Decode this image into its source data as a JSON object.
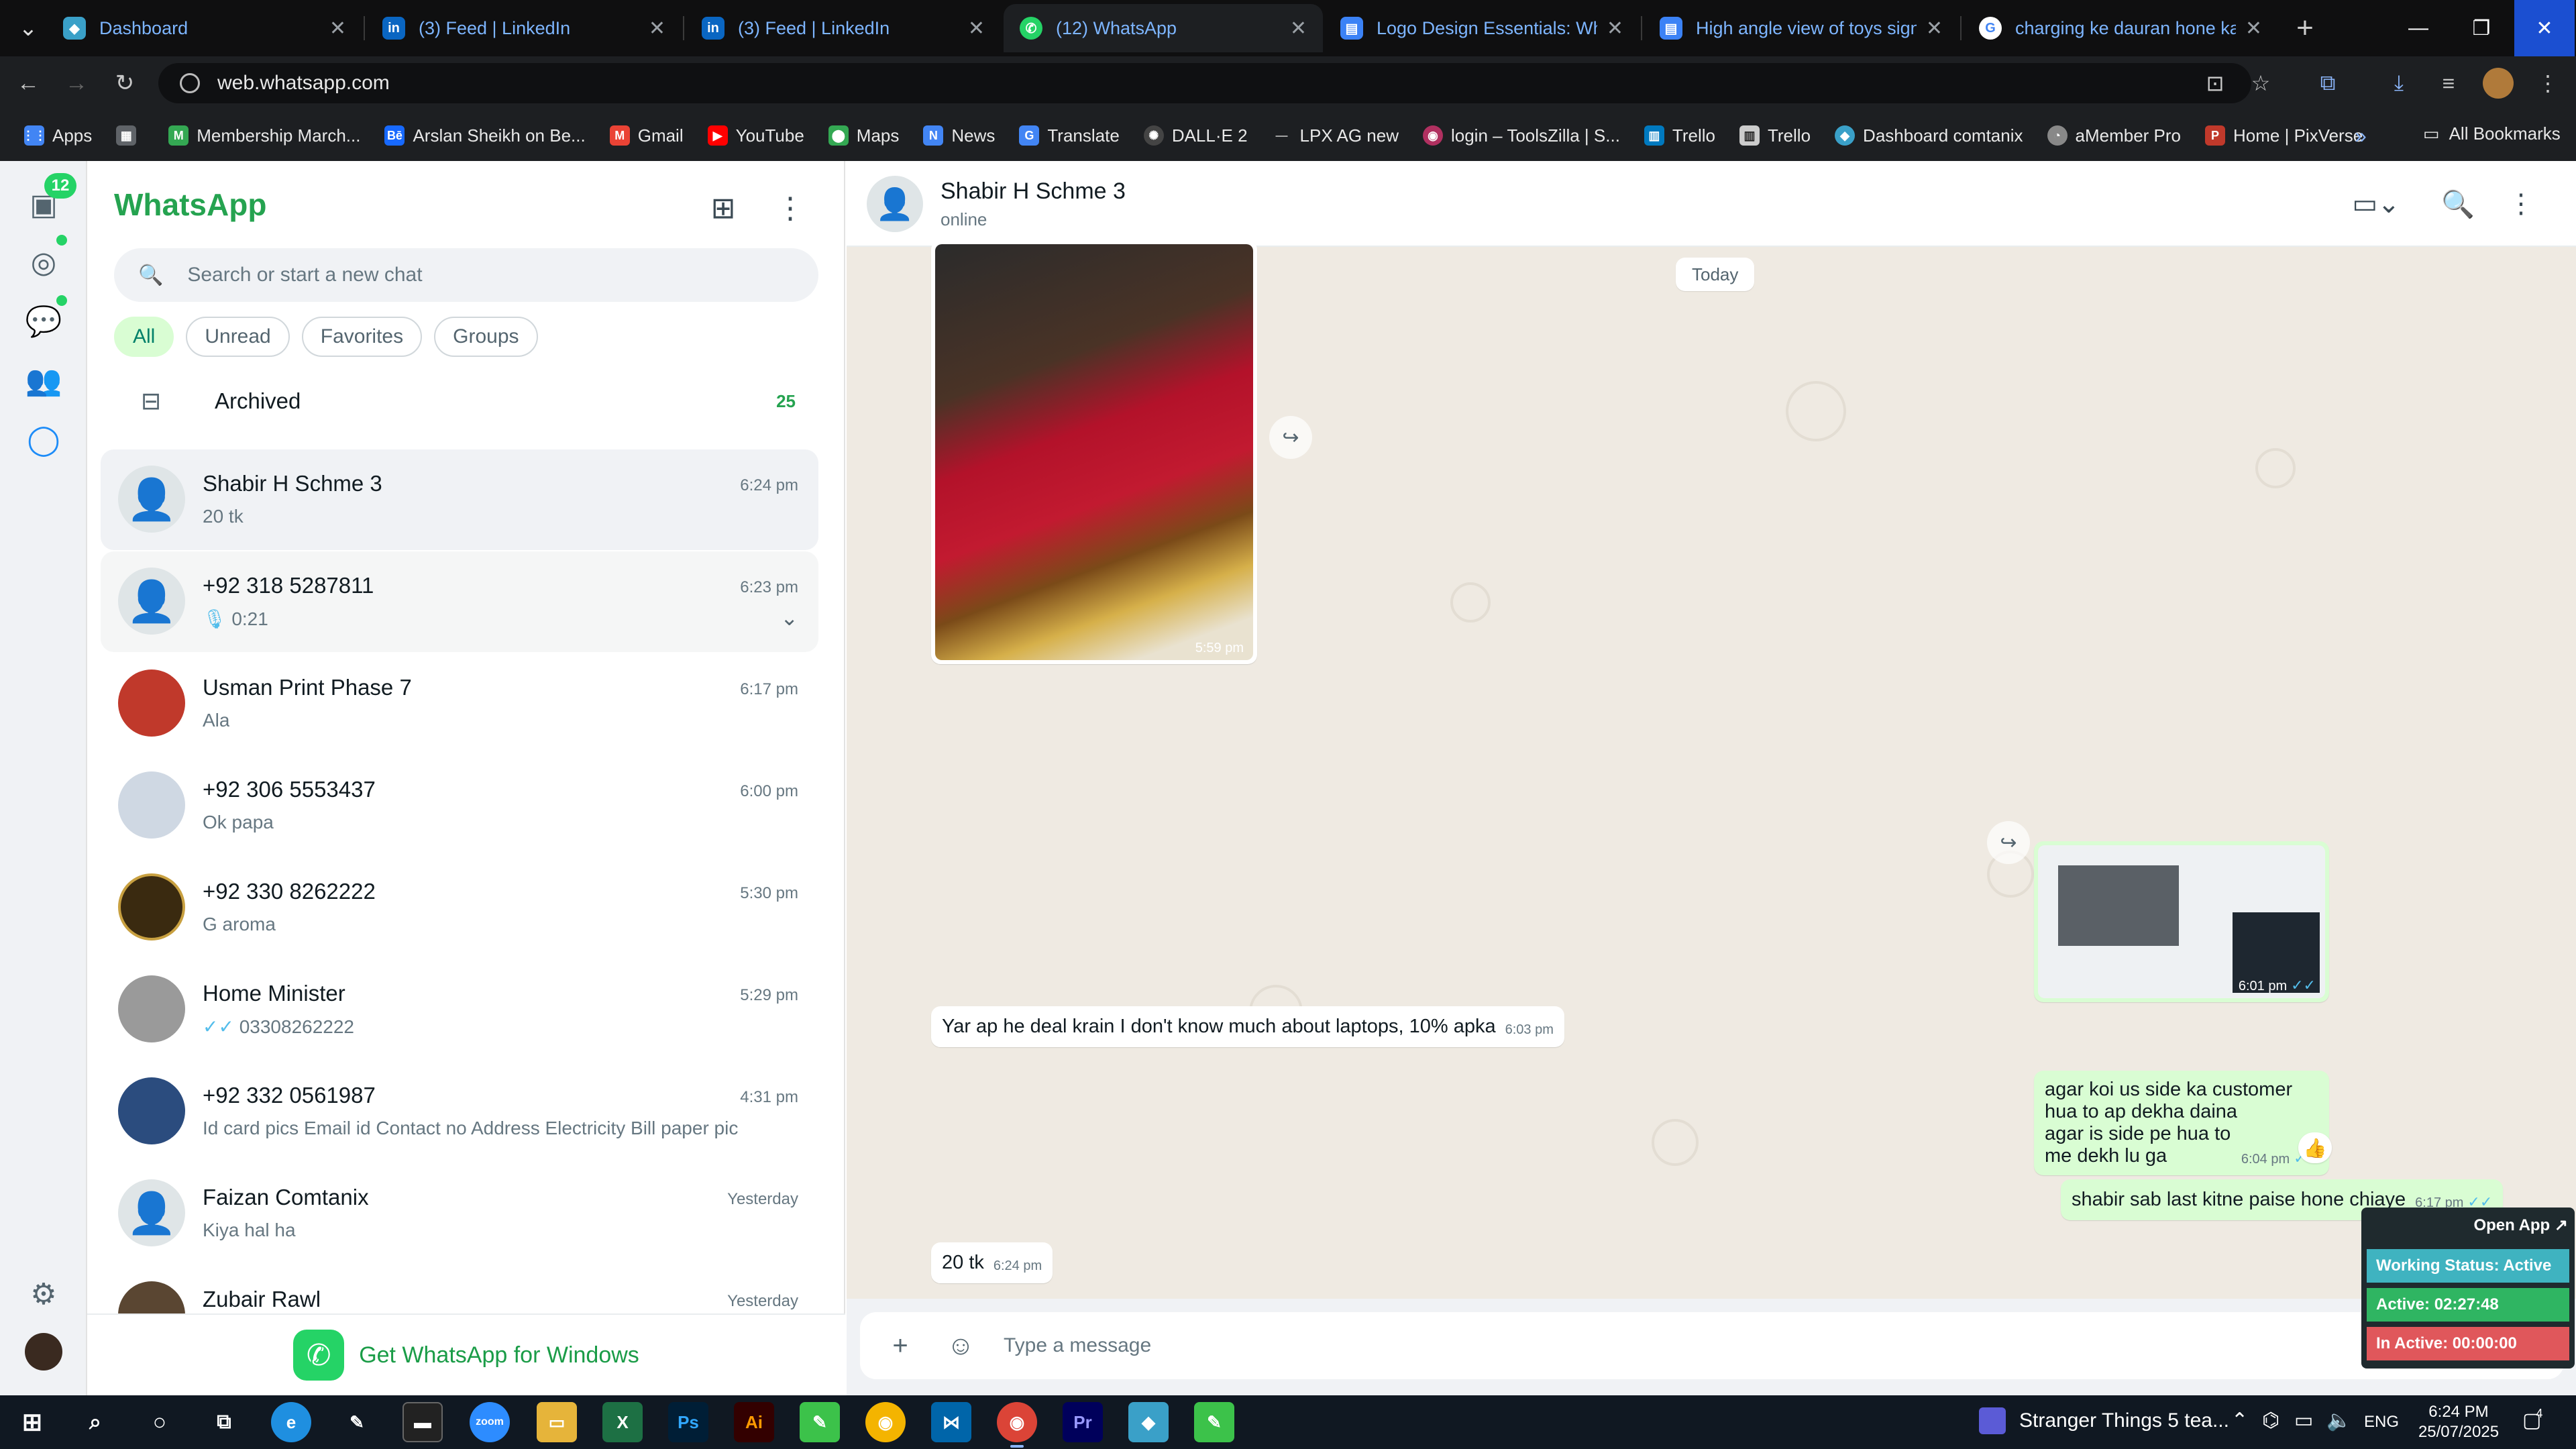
{
  "browser": {
    "tabs": [
      {
        "title": "Dashboard",
        "icon": "dashboard-favicon",
        "color": "#3aa0c8"
      },
      {
        "title": "(3) Feed | LinkedIn",
        "icon": "linkedin-favicon",
        "color": "#0a66c2"
      },
      {
        "title": "(3) Feed | LinkedIn",
        "icon": "linkedin-favicon",
        "color": "#0a66c2"
      },
      {
        "title": "(12) WhatsApp",
        "icon": "whatsapp-favicon",
        "color": "#25d366"
      },
      {
        "title": "Logo Design Essentials: What E",
        "icon": "doc-favicon",
        "color": "#3b82f6"
      },
      {
        "title": "High angle view of toys sign | F",
        "icon": "doc-favicon",
        "color": "#3b82f6"
      },
      {
        "title": "charging ke dauran hone ka us",
        "icon": "google-favicon",
        "color": "#ffffff"
      }
    ],
    "url": "web.whatsapp.com",
    "bookmarks": [
      {
        "label": "Apps",
        "icon": "apps-grid-icon",
        "color": "#4285f4"
      },
      {
        "label": "",
        "icon": "grid-icon",
        "color": "#5f6368"
      },
      {
        "label": "Membership March...",
        "icon": "membership-favicon",
        "color": "#34a853"
      },
      {
        "label": "Arslan Sheikh on Be...",
        "icon": "behance-favicon",
        "color": "#1769ff"
      },
      {
        "label": "Gmail",
        "icon": "gmail-favicon",
        "color": "#ea4335"
      },
      {
        "label": "YouTube",
        "icon": "youtube-favicon",
        "color": "#ff0000"
      },
      {
        "label": "Maps",
        "icon": "maps-favicon",
        "color": "#34a853"
      },
      {
        "label": "News",
        "icon": "news-favicon",
        "color": "#4285f4"
      },
      {
        "label": "Translate",
        "icon": "translate-favicon",
        "color": "#4285f4"
      },
      {
        "label": "DALL·E 2",
        "icon": "openai-favicon",
        "color": "#444444"
      },
      {
        "label": "LPX AG new",
        "icon": "dash-favicon",
        "color": "#666666"
      },
      {
        "label": "login – ToolsZilla | S...",
        "icon": "toolszilla-favicon",
        "color": "#b03060"
      },
      {
        "label": "Trello",
        "icon": "trello-favicon",
        "color": "#0079bf"
      },
      {
        "label": "Trello",
        "icon": "trello-favicon",
        "color": "#cccccc"
      },
      {
        "label": "Dashboard comtanix",
        "icon": "dashboard-favicon",
        "color": "#3aa0c8"
      },
      {
        "label": "aMember Pro",
        "icon": "amember-favicon",
        "color": "#888888"
      },
      {
        "label": "Home | PixVerse",
        "icon": "pixverse-favicon",
        "color": "#c0392b"
      }
    ],
    "all_bookmarks": "All Bookmarks"
  },
  "rail": {
    "badge": "12"
  },
  "sidebar": {
    "title": "WhatsApp",
    "search_placeholder": "Search or start a new chat",
    "filters": [
      "All",
      "Unread",
      "Favorites",
      "Groups"
    ],
    "archived_label": "Archived",
    "archived_count": "25",
    "chats": [
      {
        "name": "Shabir H  Schme 3",
        "time": "6:24 pm",
        "preview": "20 tk",
        "avatar": "blank"
      },
      {
        "name": "+92 318 5287811",
        "time": "6:23 pm",
        "preview": "0:21",
        "avatar": "blank",
        "voice": true
      },
      {
        "name": "Usman Print Phase 7",
        "time": "6:17 pm",
        "preview": "Ala",
        "avatar": "photo",
        "color": "#c0392b"
      },
      {
        "name": "+92 306 5553437",
        "time": "6:00 pm",
        "preview": "Ok papa",
        "avatar": "photo",
        "color": "#cfd8e3"
      },
      {
        "name": "+92 330 8262222",
        "time": "5:30 pm",
        "preview": "G aroma",
        "avatar": "photo",
        "color": "#3a2a10"
      },
      {
        "name": "Home Minister",
        "time": "5:29 pm",
        "preview": "03308262222",
        "avatar": "photo",
        "color": "#9a9a9a",
        "ticks": true
      },
      {
        "name": "+92 332 0561987",
        "time": "4:31 pm",
        "preview": "Id card pics Email id  Contact no Address Electricity Bill paper pic",
        "avatar": "photo",
        "color": "#2b4c7e"
      },
      {
        "name": "Faizan Comtanix",
        "time": "Yesterday",
        "preview": "Kiya hal ha",
        "avatar": "blank"
      },
      {
        "name": "Zubair Rawl",
        "time": "Yesterday",
        "preview": "",
        "avatar": "photo",
        "color": "#5a4632"
      }
    ],
    "get_app": "Get WhatsApp for Windows"
  },
  "conversation": {
    "name": "Shabir H  Schme 3",
    "status": "online",
    "day": "Today",
    "messages": [
      {
        "id": "img1",
        "dir": "in",
        "type": "image",
        "time": "5:59 pm"
      },
      {
        "id": "img2",
        "dir": "out",
        "type": "image",
        "time": "6:01 pm"
      },
      {
        "id": "m1",
        "dir": "in",
        "text": "Yar ap he deal krain I don't know much about laptops, 10% apka",
        "time": "6:03 pm"
      },
      {
        "id": "m2",
        "dir": "out",
        "text": "agar koi  us side ka customer hua to ap dekha daina",
        "text2": "agar is side pe hua to me dekh lu ga",
        "time": "6:04 pm",
        "reaction": "👍"
      },
      {
        "id": "m3",
        "dir": "out",
        "text": "shabir sab last kitne paise hone chiaye",
        "time": "6:17 pm"
      },
      {
        "id": "m4",
        "dir": "in",
        "text": "20 tk",
        "time": "6:24 pm"
      }
    ],
    "composer_placeholder": "Type a message"
  },
  "tracker": {
    "open_app": "Open App ↗",
    "working_status": "Working Status: Active",
    "active": "Active: 02:27:48",
    "inactive": "In Active: 00:00:00"
  },
  "taskbar": {
    "media": "Stranger Things 5 tea...",
    "lang": "ENG",
    "time": "6:24 PM",
    "date": "25/07/2025",
    "notifications": "4"
  }
}
